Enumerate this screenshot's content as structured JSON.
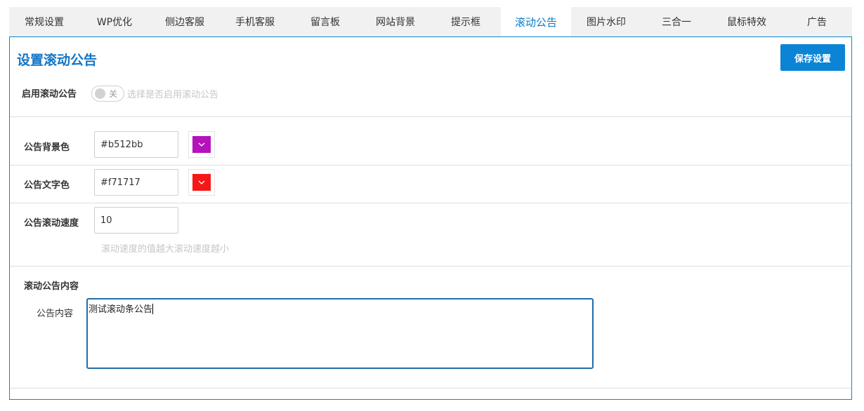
{
  "tabs": [
    {
      "label": "常规设置"
    },
    {
      "label": "WP优化"
    },
    {
      "label": "侧边客服"
    },
    {
      "label": "手机客服"
    },
    {
      "label": "留言板"
    },
    {
      "label": "网站背景"
    },
    {
      "label": "提示框"
    },
    {
      "label": "滚动公告",
      "active": true
    },
    {
      "label": "图片水印"
    },
    {
      "label": "三合一"
    },
    {
      "label": "鼠标特效"
    },
    {
      "label": "广告"
    }
  ],
  "panel": {
    "title": "设置滚动公告",
    "save_label": "保存设置"
  },
  "enable": {
    "label": "启用滚动公告",
    "toggle_text": "关",
    "toggle_on": false,
    "hint": "选择是否启用滚动公告"
  },
  "bg_color": {
    "label": "公告背景色",
    "value": "#b512bb",
    "swatch": "#b512bb"
  },
  "text_color": {
    "label": "公告文字色",
    "value": "#f71717",
    "swatch": "#f71717"
  },
  "speed": {
    "label": "公告滚动速度",
    "value": "10",
    "hint": "滚动速度的值越大滚动速度越小"
  },
  "content": {
    "section_label": "滚动公告内容",
    "field_label": "公告内容",
    "value": "测试滚动条公告"
  },
  "colors": {
    "accent": "#1275c6",
    "button": "#0b84d6",
    "active_tab_text": "#0a7cc4"
  }
}
